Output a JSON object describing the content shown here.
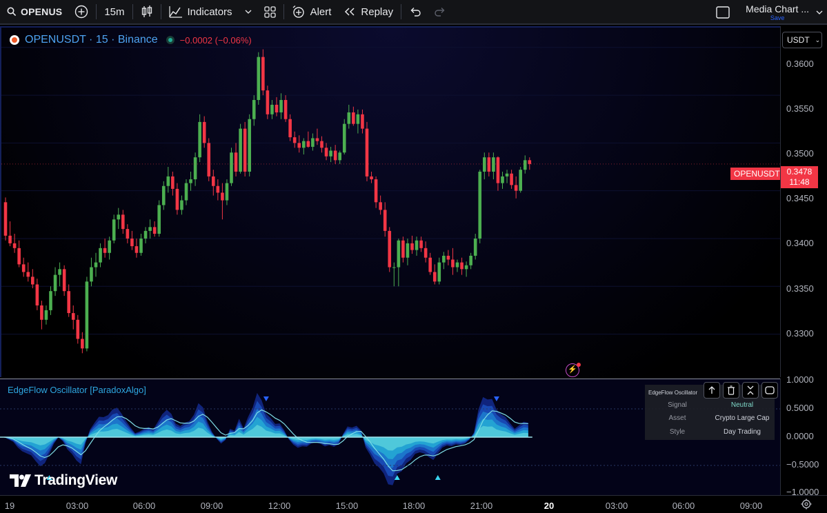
{
  "toolbar": {
    "symbol": "OPENUS",
    "interval": "15m",
    "indicators": "Indicators",
    "alert": "Alert",
    "replay": "Replay",
    "layout_name": "Media Chart ...",
    "layout_save": "Save"
  },
  "legend": {
    "symbol": "OPENUSDT · 15 · Binance",
    "change": "−0.0002 (−0.06%)"
  },
  "currency": "USDT",
  "price_axis": [
    "0.3600",
    "0.3550",
    "0.3500",
    "0.3450",
    "0.3400",
    "0.3350",
    "0.3300"
  ],
  "last_price": {
    "symbol_tag": "OPENUSDT",
    "price": "0.3478",
    "countdown": "11:48"
  },
  "oscillator": {
    "title": "EdgeFlow Oscillator [ParadoxAlgo]",
    "table_title": "EdgeFlow Oscillator",
    "rows": [
      {
        "key": "Signal",
        "value": "Neutral"
      },
      {
        "key": "Asset",
        "value": "Crypto Large Cap"
      },
      {
        "key": "Style",
        "value": "Day Trading"
      }
    ],
    "axis": [
      "1.0000",
      "0.5000",
      "0.0000",
      "−0.5000",
      "−1.0000"
    ]
  },
  "time_axis": [
    "19",
    "03:00",
    "06:00",
    "09:00",
    "12:00",
    "15:00",
    "18:00",
    "21:00",
    "20",
    "03:00",
    "06:00",
    "09:00"
  ],
  "watermark": "TradingView",
  "colors": {
    "up": "#4caf50",
    "down": "#f23645",
    "accent": "#2ea7e0",
    "background": "#000000"
  },
  "chart_data": {
    "type": "candlestick",
    "y_range": [
      0.326,
      0.3615
    ],
    "candles": [
      [
        0.3438,
        0.3443,
        0.3398,
        0.3403
      ],
      [
        0.3403,
        0.3418,
        0.3392,
        0.3395
      ],
      [
        0.3395,
        0.3405,
        0.3385,
        0.339
      ],
      [
        0.339,
        0.3398,
        0.337,
        0.3373
      ],
      [
        0.3373,
        0.338,
        0.336,
        0.3365
      ],
      [
        0.3365,
        0.3375,
        0.3355,
        0.336
      ],
      [
        0.336,
        0.3368,
        0.3348,
        0.3352
      ],
      [
        0.3352,
        0.3358,
        0.3325,
        0.333
      ],
      [
        0.333,
        0.3335,
        0.3305,
        0.3315
      ],
      [
        0.3315,
        0.333,
        0.331,
        0.3325
      ],
      [
        0.3325,
        0.335,
        0.332,
        0.3345
      ],
      [
        0.3345,
        0.337,
        0.334,
        0.3362
      ],
      [
        0.3362,
        0.3375,
        0.335,
        0.3368
      ],
      [
        0.3368,
        0.3372,
        0.334,
        0.3345
      ],
      [
        0.3345,
        0.3352,
        0.3318,
        0.3322
      ],
      [
        0.3322,
        0.333,
        0.3305,
        0.3315
      ],
      [
        0.3315,
        0.332,
        0.329,
        0.3295
      ],
      [
        0.3295,
        0.3302,
        0.328,
        0.3285
      ],
      [
        0.3285,
        0.336,
        0.3282,
        0.3355
      ],
      [
        0.3355,
        0.338,
        0.335,
        0.337
      ],
      [
        0.337,
        0.3385,
        0.336,
        0.3375
      ],
      [
        0.3375,
        0.3395,
        0.337,
        0.339
      ],
      [
        0.339,
        0.34,
        0.338,
        0.3385
      ],
      [
        0.3385,
        0.3402,
        0.3378,
        0.3398
      ],
      [
        0.3398,
        0.3425,
        0.3395,
        0.342
      ],
      [
        0.342,
        0.3432,
        0.341,
        0.3425
      ],
      [
        0.3425,
        0.343,
        0.3405,
        0.341
      ],
      [
        0.341,
        0.3415,
        0.3395,
        0.34
      ],
      [
        0.34,
        0.3408,
        0.3388,
        0.3392
      ],
      [
        0.3392,
        0.34,
        0.338,
        0.3385
      ],
      [
        0.3385,
        0.3405,
        0.3382,
        0.34
      ],
      [
        0.34,
        0.3412,
        0.3395,
        0.3408
      ],
      [
        0.3408,
        0.342,
        0.34,
        0.3412
      ],
      [
        0.3412,
        0.3418,
        0.3402,
        0.3405
      ],
      [
        0.3405,
        0.344,
        0.3402,
        0.3435
      ],
      [
        0.3435,
        0.346,
        0.343,
        0.3455
      ],
      [
        0.3455,
        0.3475,
        0.3448,
        0.3465
      ],
      [
        0.3465,
        0.347,
        0.3445,
        0.3452
      ],
      [
        0.3452,
        0.3458,
        0.3425,
        0.343
      ],
      [
        0.343,
        0.3445,
        0.3425,
        0.344
      ],
      [
        0.344,
        0.3462,
        0.3435,
        0.3458
      ],
      [
        0.3458,
        0.347,
        0.345,
        0.3462
      ],
      [
        0.3462,
        0.349,
        0.3455,
        0.3485
      ],
      [
        0.3485,
        0.353,
        0.348,
        0.3522
      ],
      [
        0.3522,
        0.3528,
        0.3495,
        0.35
      ],
      [
        0.35,
        0.3505,
        0.346,
        0.3465
      ],
      [
        0.3465,
        0.3472,
        0.3445,
        0.3455
      ],
      [
        0.3455,
        0.3462,
        0.344,
        0.3448
      ],
      [
        0.3448,
        0.3458,
        0.342,
        0.344
      ],
      [
        0.344,
        0.3462,
        0.3435,
        0.3458
      ],
      [
        0.3458,
        0.3495,
        0.3455,
        0.349
      ],
      [
        0.349,
        0.35,
        0.3465,
        0.347
      ],
      [
        0.347,
        0.352,
        0.3468,
        0.3515
      ],
      [
        0.3515,
        0.3522,
        0.3465,
        0.347
      ],
      [
        0.347,
        0.353,
        0.3465,
        0.3525
      ],
      [
        0.3525,
        0.355,
        0.3518,
        0.3545
      ],
      [
        0.3545,
        0.3595,
        0.354,
        0.359
      ],
      [
        0.359,
        0.3598,
        0.355,
        0.3555
      ],
      [
        0.3555,
        0.356,
        0.3525,
        0.353
      ],
      [
        0.353,
        0.3545,
        0.3525,
        0.354
      ],
      [
        0.354,
        0.3548,
        0.3528,
        0.3532
      ],
      [
        0.3532,
        0.3552,
        0.3525,
        0.3545
      ],
      [
        0.3545,
        0.355,
        0.3522,
        0.3525
      ],
      [
        0.3525,
        0.353,
        0.3502,
        0.3506
      ],
      [
        0.3506,
        0.3512,
        0.3495,
        0.35
      ],
      [
        0.35,
        0.3508,
        0.349,
        0.3495
      ],
      [
        0.3495,
        0.3505,
        0.3488,
        0.3502
      ],
      [
        0.3502,
        0.3512,
        0.3495,
        0.3496
      ],
      [
        0.3496,
        0.351,
        0.3492,
        0.3505
      ],
      [
        0.3505,
        0.3515,
        0.3498,
        0.3502
      ],
      [
        0.3502,
        0.3507,
        0.349,
        0.3495
      ],
      [
        0.3495,
        0.35,
        0.3482,
        0.3486
      ],
      [
        0.3486,
        0.3496,
        0.348,
        0.3492
      ],
      [
        0.3492,
        0.3498,
        0.3478,
        0.3482
      ],
      [
        0.3482,
        0.3492,
        0.3478,
        0.349
      ],
      [
        0.349,
        0.3525,
        0.3488,
        0.352
      ],
      [
        0.352,
        0.354,
        0.3515,
        0.3532
      ],
      [
        0.3532,
        0.3538,
        0.3518,
        0.352
      ],
      [
        0.352,
        0.3535,
        0.351,
        0.353
      ],
      [
        0.353,
        0.3535,
        0.351,
        0.3515
      ],
      [
        0.3515,
        0.3522,
        0.346,
        0.3465
      ],
      [
        0.3465,
        0.347,
        0.3458,
        0.3462
      ],
      [
        0.3462,
        0.3465,
        0.3432,
        0.3438
      ],
      [
        0.3438,
        0.3445,
        0.3425,
        0.343
      ],
      [
        0.343,
        0.3438,
        0.3402,
        0.3408
      ],
      [
        0.3408,
        0.3412,
        0.3365,
        0.337
      ],
      [
        0.337,
        0.3375,
        0.335,
        0.337
      ],
      [
        0.337,
        0.34,
        0.335,
        0.3398
      ],
      [
        0.3398,
        0.3402,
        0.3375,
        0.338
      ],
      [
        0.338,
        0.34,
        0.3372,
        0.3395
      ],
      [
        0.3395,
        0.3403,
        0.3384,
        0.3388
      ],
      [
        0.3388,
        0.3402,
        0.3382,
        0.3398
      ],
      [
        0.3398,
        0.3402,
        0.3386,
        0.339
      ],
      [
        0.339,
        0.3397,
        0.3375,
        0.338
      ],
      [
        0.338,
        0.3385,
        0.3362,
        0.3365
      ],
      [
        0.3365,
        0.3373,
        0.3352,
        0.3355
      ],
      [
        0.3355,
        0.338,
        0.3352,
        0.3375
      ],
      [
        0.3375,
        0.3386,
        0.3368,
        0.3382
      ],
      [
        0.3382,
        0.3388,
        0.3372,
        0.3378
      ],
      [
        0.3378,
        0.339,
        0.3362,
        0.337
      ],
      [
        0.337,
        0.3378,
        0.3365,
        0.3375
      ],
      [
        0.3375,
        0.338,
        0.3362,
        0.3368
      ],
      [
        0.3368,
        0.3376,
        0.336,
        0.3372
      ],
      [
        0.3372,
        0.3385,
        0.3368,
        0.3382
      ],
      [
        0.3382,
        0.3405,
        0.3378,
        0.34
      ],
      [
        0.34,
        0.3472,
        0.3395,
        0.347
      ],
      [
        0.347,
        0.349,
        0.3462,
        0.3485
      ],
      [
        0.3485,
        0.349,
        0.3465,
        0.347
      ],
      [
        0.347,
        0.349,
        0.3462,
        0.3485
      ],
      [
        0.3485,
        0.3486,
        0.345,
        0.3458
      ],
      [
        0.3458,
        0.347,
        0.3452,
        0.3465
      ],
      [
        0.3465,
        0.3472,
        0.3458,
        0.3468
      ],
      [
        0.3468,
        0.3472,
        0.3452,
        0.3456
      ],
      [
        0.3456,
        0.3465,
        0.3442,
        0.345
      ],
      [
        0.345,
        0.3475,
        0.3448,
        0.3472
      ],
      [
        0.3472,
        0.3487,
        0.3468,
        0.3482
      ],
      [
        0.3482,
        0.3485,
        0.3472,
        0.3478
      ]
    ]
  }
}
